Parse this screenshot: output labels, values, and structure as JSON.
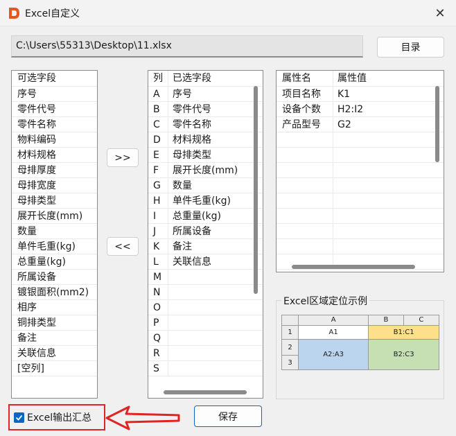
{
  "window": {
    "title": "Excel自定义"
  },
  "path": {
    "value": "C:\\Users\\55313\\Desktop\\11.xlsx"
  },
  "buttons": {
    "directory": "目录",
    "add": ">>",
    "remove": "<<",
    "save": "保存"
  },
  "available": {
    "header": "可选字段",
    "items": [
      "序号",
      "零件代号",
      "零件名称",
      "物料编码",
      "材料规格",
      "母排厚度",
      "母排宽度",
      "母排类型",
      "展开长度(mm)",
      "数量",
      "单件毛重(kg)",
      "总重量(kg)",
      "所属设备",
      "镀银面积(mm2)",
      "相序",
      "铜排类型",
      "备注",
      "关联信息",
      "[空列]"
    ]
  },
  "selected": {
    "col_header": "列",
    "name_header": "已选字段",
    "rows": [
      {
        "col": "A",
        "name": "序号"
      },
      {
        "col": "B",
        "name": "零件代号"
      },
      {
        "col": "C",
        "name": "零件名称"
      },
      {
        "col": "D",
        "name": "材料规格"
      },
      {
        "col": "E",
        "name": "母排类型"
      },
      {
        "col": "F",
        "name": "展开长度(mm)"
      },
      {
        "col": "G",
        "name": "数量"
      },
      {
        "col": "H",
        "name": "单件毛重(kg)"
      },
      {
        "col": "I",
        "name": "总重量(kg)"
      },
      {
        "col": "J",
        "name": "所属设备"
      },
      {
        "col": "K",
        "name": "备注"
      },
      {
        "col": "L",
        "name": "关联信息"
      },
      {
        "col": "M",
        "name": ""
      },
      {
        "col": "N",
        "name": ""
      },
      {
        "col": "O",
        "name": ""
      },
      {
        "col": "P",
        "name": ""
      },
      {
        "col": "Q",
        "name": ""
      },
      {
        "col": "R",
        "name": ""
      },
      {
        "col": "S",
        "name": ""
      }
    ]
  },
  "properties": {
    "name_header": "属性名",
    "value_header": "属性值",
    "rows": [
      {
        "name": "项目名称",
        "value": "K1"
      },
      {
        "name": "设备个数",
        "value": "H2:I2"
      },
      {
        "name": "产品型号",
        "value": "G2"
      }
    ]
  },
  "example": {
    "title": "Excel区域定位示例",
    "col_headers": [
      "A",
      "B",
      "C"
    ],
    "row_headers": [
      "1",
      "2",
      "3"
    ],
    "cells": {
      "a1": "A1",
      "b1c1": "B1:C1",
      "a2a3": "A2:A3",
      "b2c3": "B2:C3"
    },
    "colors": {
      "b1c1": "#ffe08a",
      "a2a3": "#bcd5ee",
      "b2c3": "#c6e0b4"
    }
  },
  "options": {
    "excel_summary_label": "Excel输出汇总",
    "excel_summary_checked": true
  },
  "colors": {
    "accent": "#0a66c2",
    "highlight": "#e02424",
    "app_icon": "#e8541e"
  }
}
